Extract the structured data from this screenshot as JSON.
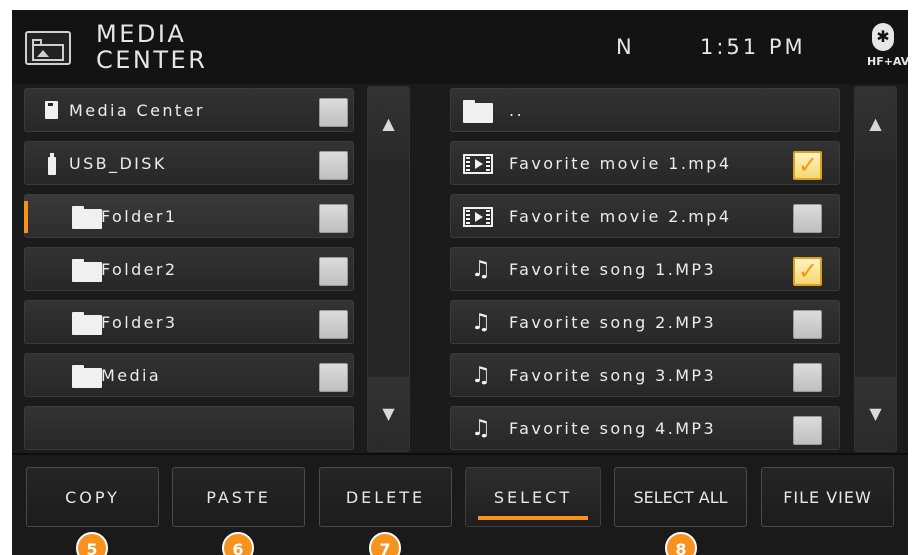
{
  "header": {
    "title_line1": "MEDIA",
    "title_line2": "CENTER",
    "compass": "N",
    "clock": "1:51 PM",
    "bt_label": "HF+AV",
    "bt_glyph": "✱"
  },
  "left_list": {
    "items": [
      {
        "label": "Media Center",
        "icon": "sd-card-icon",
        "checked": false
      },
      {
        "label": "USB_DISK",
        "icon": "usb-icon",
        "checked": false
      },
      {
        "label": "Folder1",
        "icon": "folder-icon",
        "checked": false,
        "selected": true
      },
      {
        "label": "Folder2",
        "icon": "folder-icon",
        "checked": false
      },
      {
        "label": "Folder3",
        "icon": "folder-icon",
        "checked": false
      },
      {
        "label": "Media",
        "icon": "folder-icon",
        "checked": false
      }
    ]
  },
  "right_list": {
    "items": [
      {
        "label": "..",
        "icon": "folder-icon"
      },
      {
        "label": "Favorite movie 1.mp4",
        "icon": "video-icon",
        "checked": true
      },
      {
        "label": "Favorite movie 2.mp4",
        "icon": "video-icon",
        "checked": false
      },
      {
        "label": "Favorite song 1.MP3",
        "icon": "music-note-icon",
        "checked": true
      },
      {
        "label": "Favorite song 2.MP3",
        "icon": "music-note-icon",
        "checked": false
      },
      {
        "label": "Favorite song 3.MP3",
        "icon": "music-note-icon",
        "checked": false
      },
      {
        "label": "Favorite song 4.MP3",
        "icon": "music-note-icon",
        "checked": false
      }
    ]
  },
  "scroll": {
    "up": "▲",
    "down": "▼"
  },
  "toolbar": {
    "copy": "COPY",
    "paste": "PASTE",
    "delete": "DELETE",
    "select": "SELECT",
    "select_all": "SELECT ALL",
    "file_view": "FILE VIEW",
    "active": "SELECT"
  },
  "badges": {
    "copy": "5",
    "paste": "6",
    "delete": "7",
    "select_all": "8"
  },
  "checkmark": "✓",
  "colors": {
    "accent": "#f7921e",
    "background": "#1b1b1b",
    "row": "#2e2e2e",
    "text": "#ececec"
  }
}
